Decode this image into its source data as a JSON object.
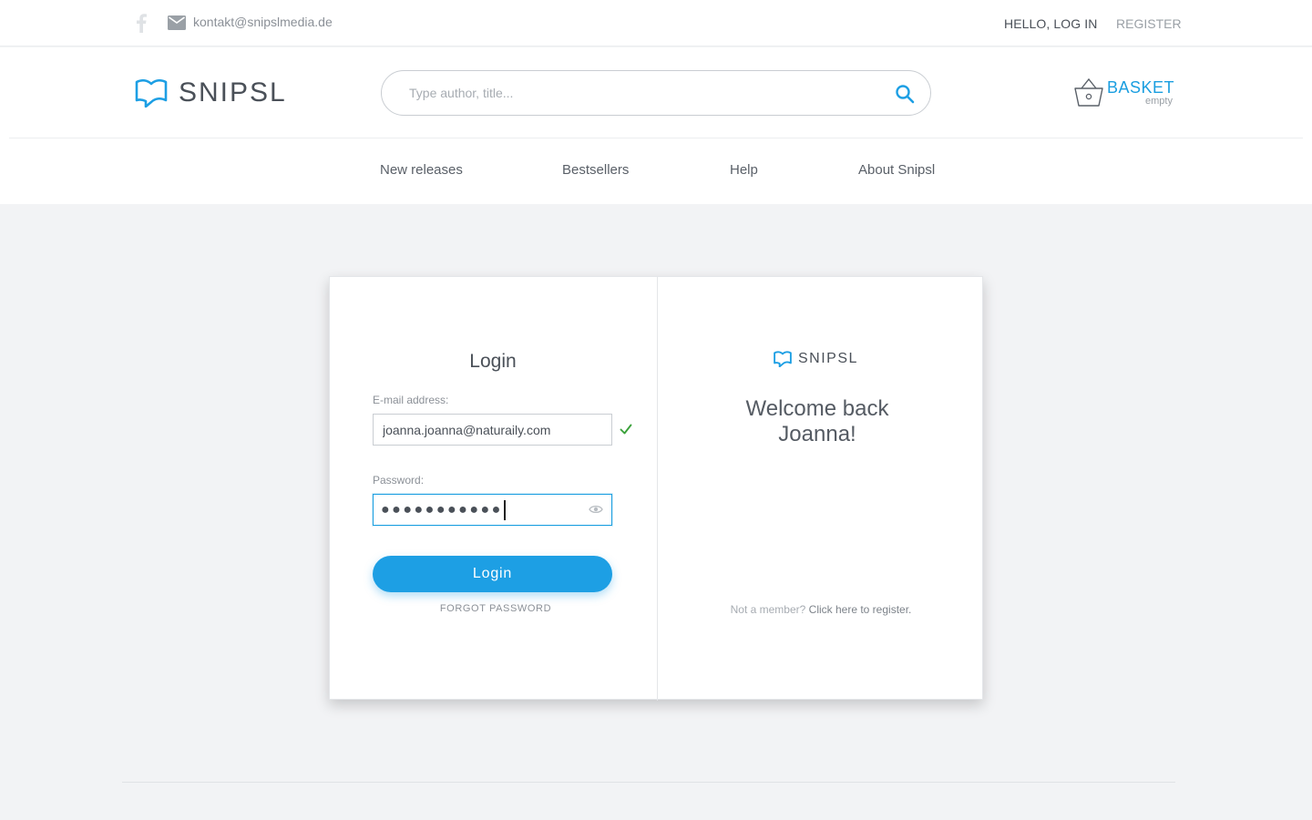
{
  "topbar": {
    "email": "kontakt@snipslmedia.de",
    "hello_login": "HELLO, LOG IN",
    "register": "REGISTER"
  },
  "header": {
    "logo_text": "SNIPSL",
    "search_placeholder": "Type author, title...",
    "basket_label": "BASKET",
    "basket_status": "empty"
  },
  "nav": {
    "items": [
      {
        "label": "New releases"
      },
      {
        "label": "Bestsellers"
      },
      {
        "label": "Help"
      },
      {
        "label": "About Snipsl"
      }
    ]
  },
  "login": {
    "title": "Login",
    "email_label": "E-mail address:",
    "email_value": "joanna.joanna@naturaily.com",
    "password_label": "Password:",
    "password_mask": "●●●●●●●●●●●",
    "button_label": "Login",
    "forgot_label": "FORGOT PASSWORD"
  },
  "welcome": {
    "logo_text": "SNIPSL",
    "line1": "Welcome back",
    "line2": "Joanna!",
    "not_member": "Not a member?",
    "register_link": "Click here to register."
  },
  "colors": {
    "accent": "#1d9fe4",
    "text": "#4a5058",
    "muted": "#8b9097",
    "background": "#f2f3f5",
    "success": "#3aa13a"
  },
  "icons": [
    "facebook-icon",
    "mail-icon",
    "search-icon",
    "basket-icon",
    "check-icon",
    "eye-icon",
    "snipsl-logo-icon"
  ]
}
